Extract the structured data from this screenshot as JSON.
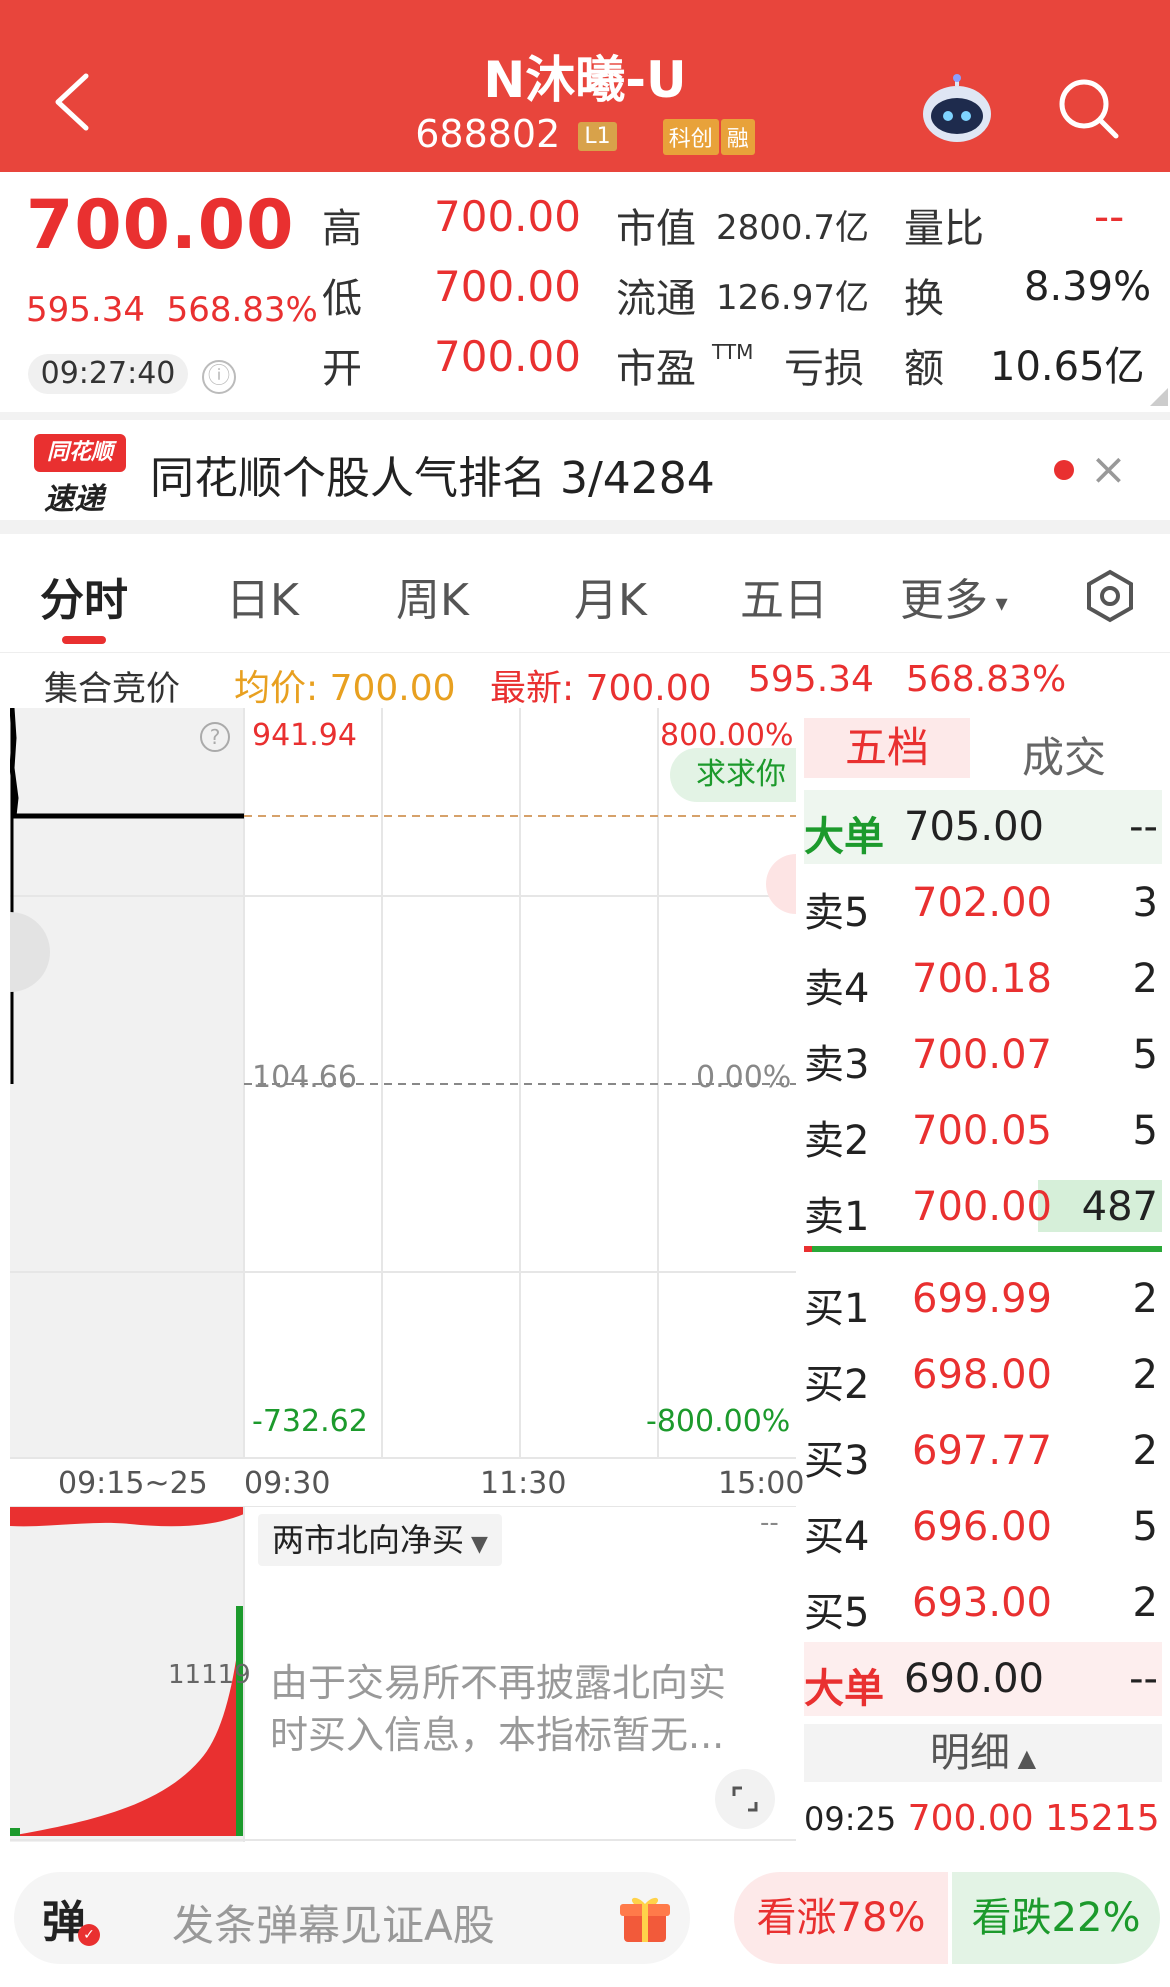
{
  "header": {
    "title": "N沐曦-U",
    "code": "688802",
    "tags": [
      "L1",
      "科创",
      "融"
    ]
  },
  "quote": {
    "price": "700.00",
    "change": "595.34",
    "change_pct": "568.83%",
    "time": "09:27:40",
    "info_icon": "ⓘ",
    "stats": {
      "high_label": "高",
      "high": "700.00",
      "low_label": "低",
      "low": "700.00",
      "open_label": "开",
      "open": "700.00",
      "mcap_label": "市值",
      "mcap": "2800.7亿",
      "float_label": "流通",
      "float": "126.97亿",
      "pe_label": "市盈",
      "pe_ttm": "TTM",
      "pe": "亏损",
      "vr_label": "量比",
      "vr": "--",
      "turnover_label": "换",
      "turnover": "8.39%",
      "amount_label": "额",
      "amount": "10.65亿"
    }
  },
  "banner": {
    "logo_top": "同花顺",
    "logo_bottom": "速递",
    "text": "同花顺个股人气排名 3/4284"
  },
  "tabs": [
    "分时",
    "日K",
    "周K",
    "月K",
    "五日",
    "更多"
  ],
  "avg_row": {
    "label": "集合竞价",
    "avg": "均价: 700.00",
    "latest": "最新: 700.00",
    "change": "595.34",
    "pct": "568.83%"
  },
  "chart": {
    "help": "?",
    "y_top": "941.94",
    "y_mid": "104.66",
    "y_bot": "-732.62",
    "pct_top": "800.00%",
    "pct_mid": "0.00%",
    "pct_bot": "-800.00%",
    "float_button": "求求你",
    "x_labels": [
      "09:15~25",
      "09:30",
      "11:30",
      "15:00"
    ],
    "volume_label": "11119",
    "dash": "--",
    "indicator_select": "两市北向净买",
    "indicator_msg_1": "由于交易所不再披露北向实",
    "indicator_msg_2": "时买入信息，本指标暂无..."
  },
  "order_book": {
    "tab_active": "五档",
    "tab_other": "成交",
    "big_sell": {
      "label": "大单",
      "price": "705.00",
      "vol": "--"
    },
    "asks": [
      {
        "label": "卖5",
        "price": "702.00",
        "vol": "3"
      },
      {
        "label": "卖4",
        "price": "700.18",
        "vol": "2"
      },
      {
        "label": "卖3",
        "price": "700.07",
        "vol": "5"
      },
      {
        "label": "卖2",
        "price": "700.05",
        "vol": "5"
      },
      {
        "label": "卖1",
        "price": "700.00",
        "vol": "487"
      }
    ],
    "bids": [
      {
        "label": "买1",
        "price": "699.99",
        "vol": "2"
      },
      {
        "label": "买2",
        "price": "698.00",
        "vol": "2"
      },
      {
        "label": "买3",
        "price": "697.77",
        "vol": "2"
      },
      {
        "label": "买4",
        "price": "696.00",
        "vol": "5"
      },
      {
        "label": "买5",
        "price": "693.00",
        "vol": "2"
      }
    ],
    "big_buy": {
      "label": "大单",
      "price": "690.00",
      "vol": "--"
    },
    "detail_label": "明细",
    "trade": {
      "time": "09:25",
      "price": "700.00",
      "vol": "15215"
    }
  },
  "bottom": {
    "danmu_icon": "弹",
    "danmu_placeholder": "发条弹幕见证A股",
    "bull": "看涨78%",
    "bear": "看跌22%"
  }
}
